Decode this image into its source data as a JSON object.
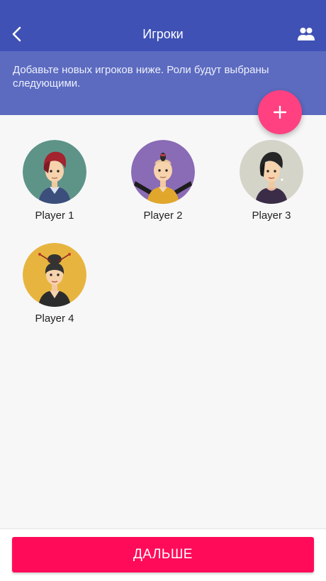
{
  "header": {
    "title": "Игроки",
    "back_icon": "back-chevron-icon",
    "players_icon": "people-icon"
  },
  "banner": {
    "text": "Добавьте новых игроков ниже. Роли будут выбраны следующими."
  },
  "add_button": {
    "icon": "plus-icon"
  },
  "players": [
    {
      "name": "Player 1",
      "avatar_bg": "#5e9488"
    },
    {
      "name": "Player 2",
      "avatar_bg": "#8a6bb5"
    },
    {
      "name": "Player 3",
      "avatar_bg": "#d4d4c8"
    },
    {
      "name": "Player 4",
      "avatar_bg": "#e7b53f"
    }
  ],
  "footer": {
    "next_label": "ДАЛЬШЕ"
  },
  "colors": {
    "primary": "#3f51b5",
    "banner": "#5c6bc0",
    "fab": "#ff4081",
    "next_button": "#ff0b5a"
  }
}
